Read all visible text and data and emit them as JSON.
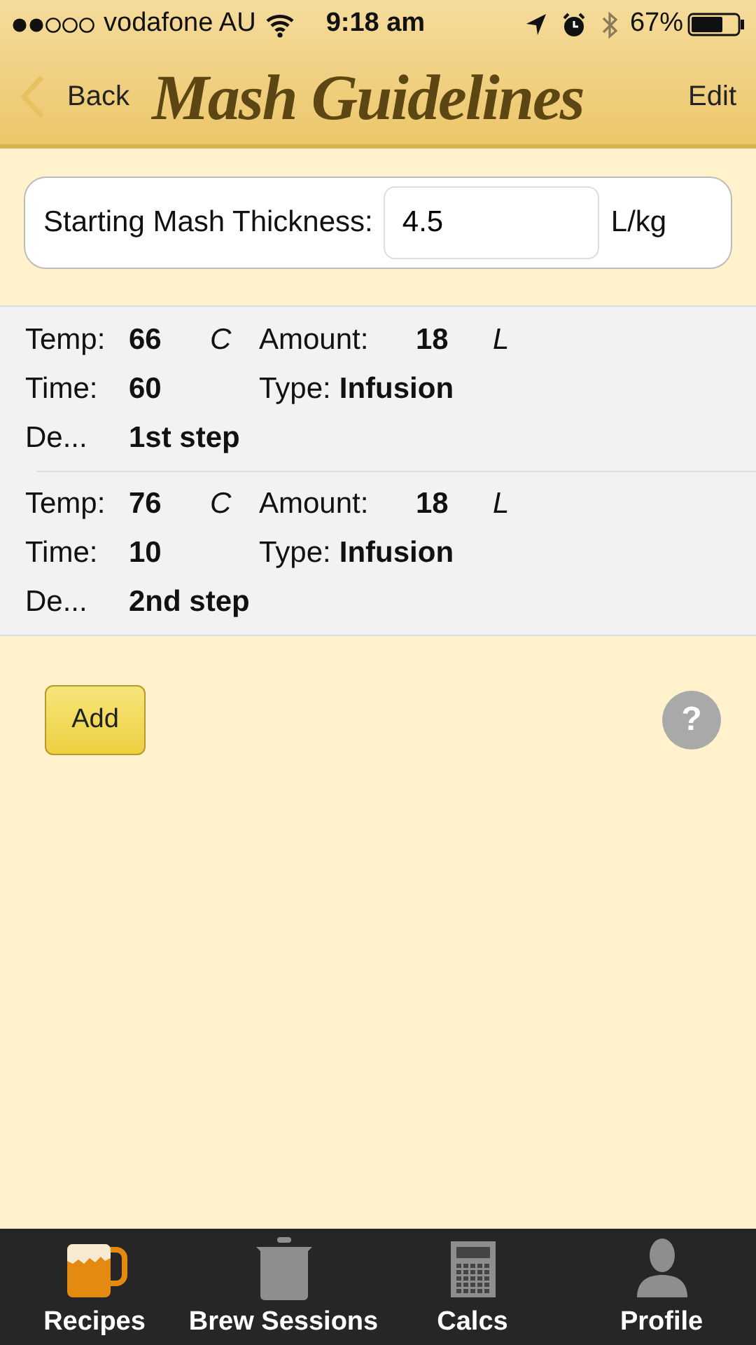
{
  "status_bar": {
    "carrier": "vodafone AU",
    "time": "9:18 am",
    "battery": "67%"
  },
  "nav": {
    "back": "Back",
    "title": "Mash Guidelines",
    "edit": "Edit"
  },
  "thickness": {
    "label": "Starting Mash Thickness:",
    "value": "4.5",
    "unit": "L/kg"
  },
  "steps": [
    {
      "temp_label": "Temp:",
      "temp": "66",
      "temp_unit": "C",
      "amount_label": "Amount:",
      "amount": "18",
      "amount_unit": "L",
      "time_label": "Time:",
      "time": "60",
      "type_label": "Type:",
      "type": "Infusion",
      "desc_label": "De...",
      "desc": "1st step"
    },
    {
      "temp_label": "Temp:",
      "temp": "76",
      "temp_unit": "C",
      "amount_label": "Amount:",
      "amount": "18",
      "amount_unit": "L",
      "time_label": "Time:",
      "time": "10",
      "type_label": "Type:",
      "type": "Infusion",
      "desc_label": "De...",
      "desc": "2nd step"
    }
  ],
  "add_button": "Add",
  "help": "?",
  "tabs": [
    {
      "label": "Recipes",
      "kind": "mug",
      "selected": true
    },
    {
      "label": "Brew Sessions",
      "kind": "pot",
      "selected": false
    },
    {
      "label": "Calcs",
      "kind": "calculator",
      "selected": false
    },
    {
      "label": "Profile",
      "kind": "person",
      "selected": false
    }
  ]
}
